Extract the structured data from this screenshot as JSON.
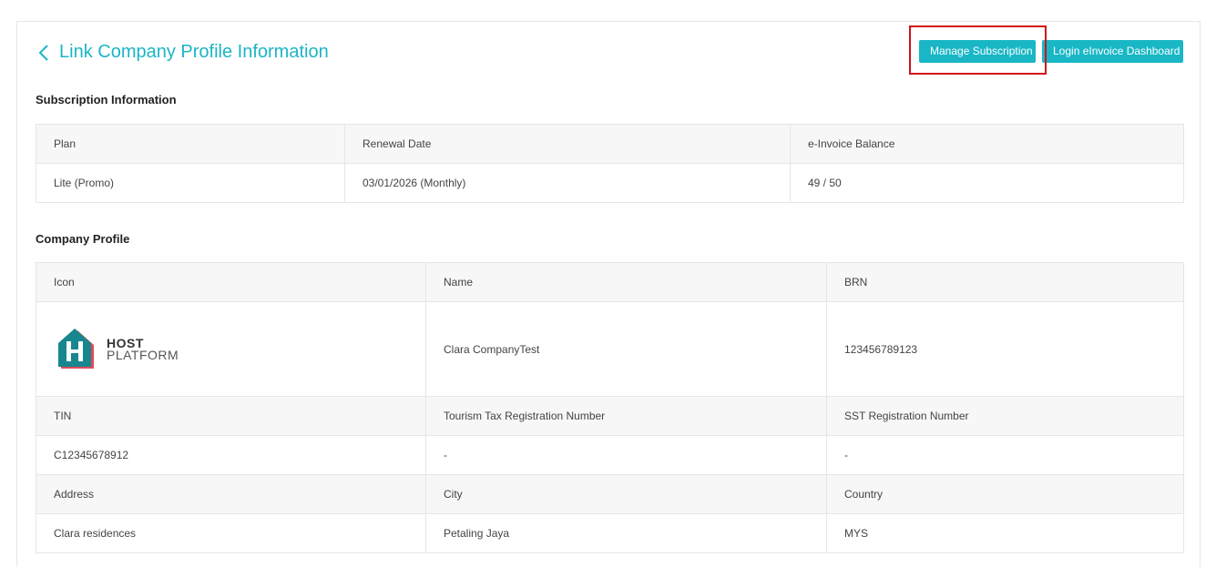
{
  "header": {
    "title": "Link Company Profile Information",
    "manage_subscription_label": "Manage Subscription",
    "login_dashboard_label": "Login eInvoice Dashboard"
  },
  "subscription": {
    "section_title": "Subscription Information",
    "columns": [
      "Plan",
      "Renewal Date",
      "e-Invoice Balance"
    ],
    "row": [
      "Lite (Promo)",
      "03/01/2026 (Monthly)",
      "49 / 50"
    ]
  },
  "company": {
    "section_title": "Company Profile",
    "rows": [
      {
        "headers": [
          "Icon",
          "Name",
          "BRN"
        ],
        "values": [
          "",
          "Clara CompanyTest",
          "123456789123"
        ]
      },
      {
        "headers": [
          "TIN",
          "Tourism Tax Registration Number",
          "SST Registration Number"
        ],
        "values": [
          "C12345678912",
          "-",
          "-"
        ]
      },
      {
        "headers": [
          "Address",
          "City",
          "Country"
        ],
        "values": [
          "Clara residences",
          "Petaling Jaya",
          "MYS"
        ]
      }
    ],
    "logo": {
      "line1": "HOST",
      "line2": "PLATFORM"
    }
  },
  "colors": {
    "accent": "#19b7c6",
    "highlight": "#d0121b"
  }
}
